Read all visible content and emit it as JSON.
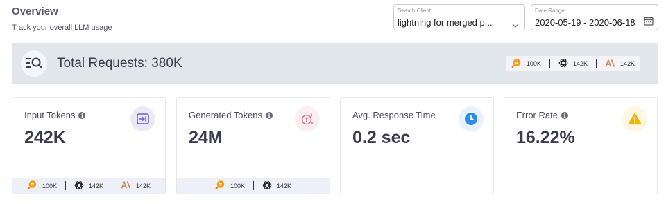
{
  "header": {
    "title": "Overview",
    "subtitle": "Track your overall LLM usage"
  },
  "search_client": {
    "label": "Search Client",
    "value": "lightning for merged p..."
  },
  "date_range": {
    "label": "Date Range",
    "value": "2020-05-19 - 2020-06-18"
  },
  "total_requests": {
    "text": "Total Requests: 380K",
    "providers": [
      {
        "icon": "search-provider-icon",
        "value": "100K"
      },
      {
        "icon": "openai-icon",
        "value": "142K"
      },
      {
        "icon": "anthropic-icon",
        "value": "142K"
      }
    ]
  },
  "cards": [
    {
      "label": "Input Tokens",
      "value": "242K",
      "icon": "input-icon",
      "icon_color": "#6c5fd6",
      "icon_bg": "#ebe9f8",
      "footer": [
        "100K",
        "142K",
        "142K"
      ]
    },
    {
      "label": "Generated Tokens",
      "value": "24M",
      "icon": "sparkle-text-icon",
      "icon_color": "#d9707c",
      "icon_bg": "#fbeef0",
      "footer": [
        "100K",
        "142K"
      ]
    },
    {
      "label": "Avg. Response Time",
      "value": "0.2 sec",
      "icon": "clock-icon",
      "icon_color": "#2e8de2",
      "icon_bg": "#e8f2fc"
    },
    {
      "label": "Error Rate",
      "value": "16.22%",
      "icon": "warning-icon",
      "icon_color": "#f4b400",
      "icon_bg": "#fdf6e3"
    }
  ]
}
